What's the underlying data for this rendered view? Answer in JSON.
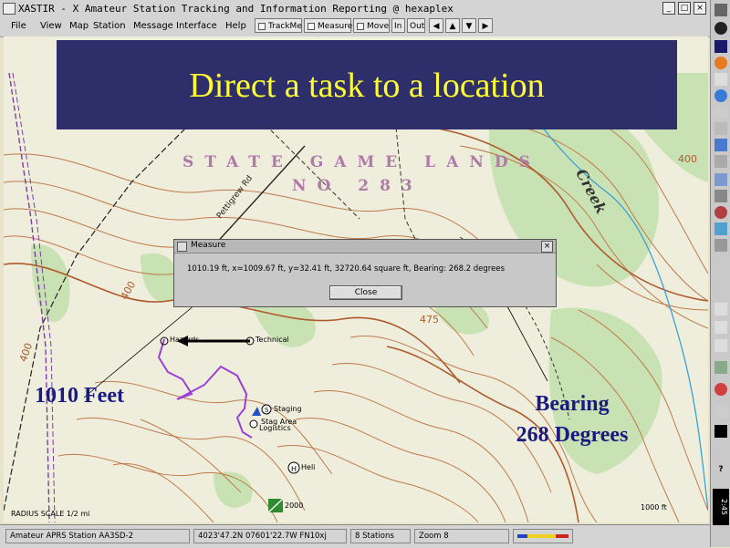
{
  "window": {
    "title": "XASTIR - X Amateur Station Tracking and Information Reporting @ hexaplex",
    "controls": [
      "_",
      "□",
      "×"
    ]
  },
  "menubar": {
    "menus": [
      "File",
      "View",
      "Map",
      "Station",
      "Message",
      "Interface",
      "Help"
    ],
    "toggles": [
      "TrackMe",
      "Measure",
      "Move"
    ],
    "zoom_in": "In",
    "zoom_out": "Out"
  },
  "banner": {
    "title": "Direct a task to a location"
  },
  "map": {
    "state_game_lands_line1": "STATE GAME LANDS",
    "state_game_lands_line2": "NO 283",
    "creek_label": "Creek",
    "road_label": "Pettigrew Rd",
    "elevations": [
      "400",
      "400",
      "475",
      "400"
    ],
    "stations": {
      "technical": "Technical",
      "hazards": "Hazards",
      "staging": "Staging",
      "logistics": "Logistics",
      "staging_area": "Stag Area",
      "heli": "Heli",
      "area_2000": "2000"
    },
    "scale_left": "RADIUS SCALE 1/2 mi",
    "scale_right": "1000 ft"
  },
  "measure_dialog": {
    "title": "Measure",
    "message": "1010.19 ft,  x=1009.67 ft,  y=32.41 ft,  32720.64 square ft,  Bearing: 268.2 degrees",
    "close_label": "Close"
  },
  "callouts": {
    "distance": "1010 Feet",
    "bearing_line1": "Bearing",
    "bearing_line2": "268 Degrees"
  },
  "statusbar": {
    "station": "Amateur APRS Station AA3SD-2",
    "position": "4023'47.2N  07601'22.7W  FN10xj",
    "stations": "8 Stations",
    "zoom": "Zoom 8"
  },
  "right_panel": {
    "clock": "2:45",
    "help": "?"
  }
}
